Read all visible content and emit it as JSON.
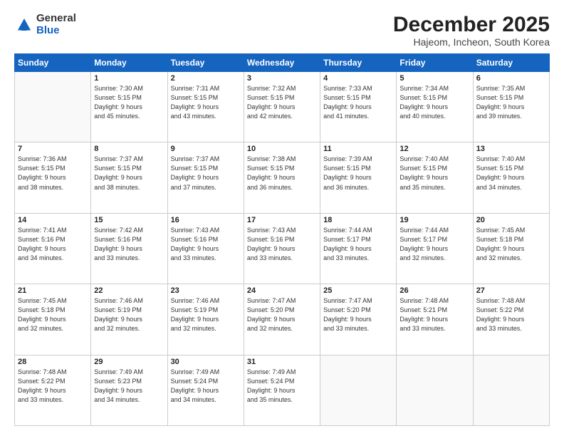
{
  "logo": {
    "general": "General",
    "blue": "Blue"
  },
  "header": {
    "month": "December 2025",
    "location": "Hajeom, Incheon, South Korea"
  },
  "days_of_week": [
    "Sunday",
    "Monday",
    "Tuesday",
    "Wednesday",
    "Thursday",
    "Friday",
    "Saturday"
  ],
  "weeks": [
    [
      {
        "day": "",
        "info": ""
      },
      {
        "day": "1",
        "info": "Sunrise: 7:30 AM\nSunset: 5:15 PM\nDaylight: 9 hours\nand 45 minutes."
      },
      {
        "day": "2",
        "info": "Sunrise: 7:31 AM\nSunset: 5:15 PM\nDaylight: 9 hours\nand 43 minutes."
      },
      {
        "day": "3",
        "info": "Sunrise: 7:32 AM\nSunset: 5:15 PM\nDaylight: 9 hours\nand 42 minutes."
      },
      {
        "day": "4",
        "info": "Sunrise: 7:33 AM\nSunset: 5:15 PM\nDaylight: 9 hours\nand 41 minutes."
      },
      {
        "day": "5",
        "info": "Sunrise: 7:34 AM\nSunset: 5:15 PM\nDaylight: 9 hours\nand 40 minutes."
      },
      {
        "day": "6",
        "info": "Sunrise: 7:35 AM\nSunset: 5:15 PM\nDaylight: 9 hours\nand 39 minutes."
      }
    ],
    [
      {
        "day": "7",
        "info": "Sunrise: 7:36 AM\nSunset: 5:15 PM\nDaylight: 9 hours\nand 38 minutes."
      },
      {
        "day": "8",
        "info": "Sunrise: 7:37 AM\nSunset: 5:15 PM\nDaylight: 9 hours\nand 38 minutes."
      },
      {
        "day": "9",
        "info": "Sunrise: 7:37 AM\nSunset: 5:15 PM\nDaylight: 9 hours\nand 37 minutes."
      },
      {
        "day": "10",
        "info": "Sunrise: 7:38 AM\nSunset: 5:15 PM\nDaylight: 9 hours\nand 36 minutes."
      },
      {
        "day": "11",
        "info": "Sunrise: 7:39 AM\nSunset: 5:15 PM\nDaylight: 9 hours\nand 36 minutes."
      },
      {
        "day": "12",
        "info": "Sunrise: 7:40 AM\nSunset: 5:15 PM\nDaylight: 9 hours\nand 35 minutes."
      },
      {
        "day": "13",
        "info": "Sunrise: 7:40 AM\nSunset: 5:15 PM\nDaylight: 9 hours\nand 34 minutes."
      }
    ],
    [
      {
        "day": "14",
        "info": "Sunrise: 7:41 AM\nSunset: 5:16 PM\nDaylight: 9 hours\nand 34 minutes."
      },
      {
        "day": "15",
        "info": "Sunrise: 7:42 AM\nSunset: 5:16 PM\nDaylight: 9 hours\nand 33 minutes."
      },
      {
        "day": "16",
        "info": "Sunrise: 7:43 AM\nSunset: 5:16 PM\nDaylight: 9 hours\nand 33 minutes."
      },
      {
        "day": "17",
        "info": "Sunrise: 7:43 AM\nSunset: 5:16 PM\nDaylight: 9 hours\nand 33 minutes."
      },
      {
        "day": "18",
        "info": "Sunrise: 7:44 AM\nSunset: 5:17 PM\nDaylight: 9 hours\nand 33 minutes."
      },
      {
        "day": "19",
        "info": "Sunrise: 7:44 AM\nSunset: 5:17 PM\nDaylight: 9 hours\nand 32 minutes."
      },
      {
        "day": "20",
        "info": "Sunrise: 7:45 AM\nSunset: 5:18 PM\nDaylight: 9 hours\nand 32 minutes."
      }
    ],
    [
      {
        "day": "21",
        "info": "Sunrise: 7:45 AM\nSunset: 5:18 PM\nDaylight: 9 hours\nand 32 minutes."
      },
      {
        "day": "22",
        "info": "Sunrise: 7:46 AM\nSunset: 5:19 PM\nDaylight: 9 hours\nand 32 minutes."
      },
      {
        "day": "23",
        "info": "Sunrise: 7:46 AM\nSunset: 5:19 PM\nDaylight: 9 hours\nand 32 minutes."
      },
      {
        "day": "24",
        "info": "Sunrise: 7:47 AM\nSunset: 5:20 PM\nDaylight: 9 hours\nand 32 minutes."
      },
      {
        "day": "25",
        "info": "Sunrise: 7:47 AM\nSunset: 5:20 PM\nDaylight: 9 hours\nand 33 minutes."
      },
      {
        "day": "26",
        "info": "Sunrise: 7:48 AM\nSunset: 5:21 PM\nDaylight: 9 hours\nand 33 minutes."
      },
      {
        "day": "27",
        "info": "Sunrise: 7:48 AM\nSunset: 5:22 PM\nDaylight: 9 hours\nand 33 minutes."
      }
    ],
    [
      {
        "day": "28",
        "info": "Sunrise: 7:48 AM\nSunset: 5:22 PM\nDaylight: 9 hours\nand 33 minutes."
      },
      {
        "day": "29",
        "info": "Sunrise: 7:49 AM\nSunset: 5:23 PM\nDaylight: 9 hours\nand 34 minutes."
      },
      {
        "day": "30",
        "info": "Sunrise: 7:49 AM\nSunset: 5:24 PM\nDaylight: 9 hours\nand 34 minutes."
      },
      {
        "day": "31",
        "info": "Sunrise: 7:49 AM\nSunset: 5:24 PM\nDaylight: 9 hours\nand 35 minutes."
      },
      {
        "day": "",
        "info": ""
      },
      {
        "day": "",
        "info": ""
      },
      {
        "day": "",
        "info": ""
      }
    ]
  ]
}
